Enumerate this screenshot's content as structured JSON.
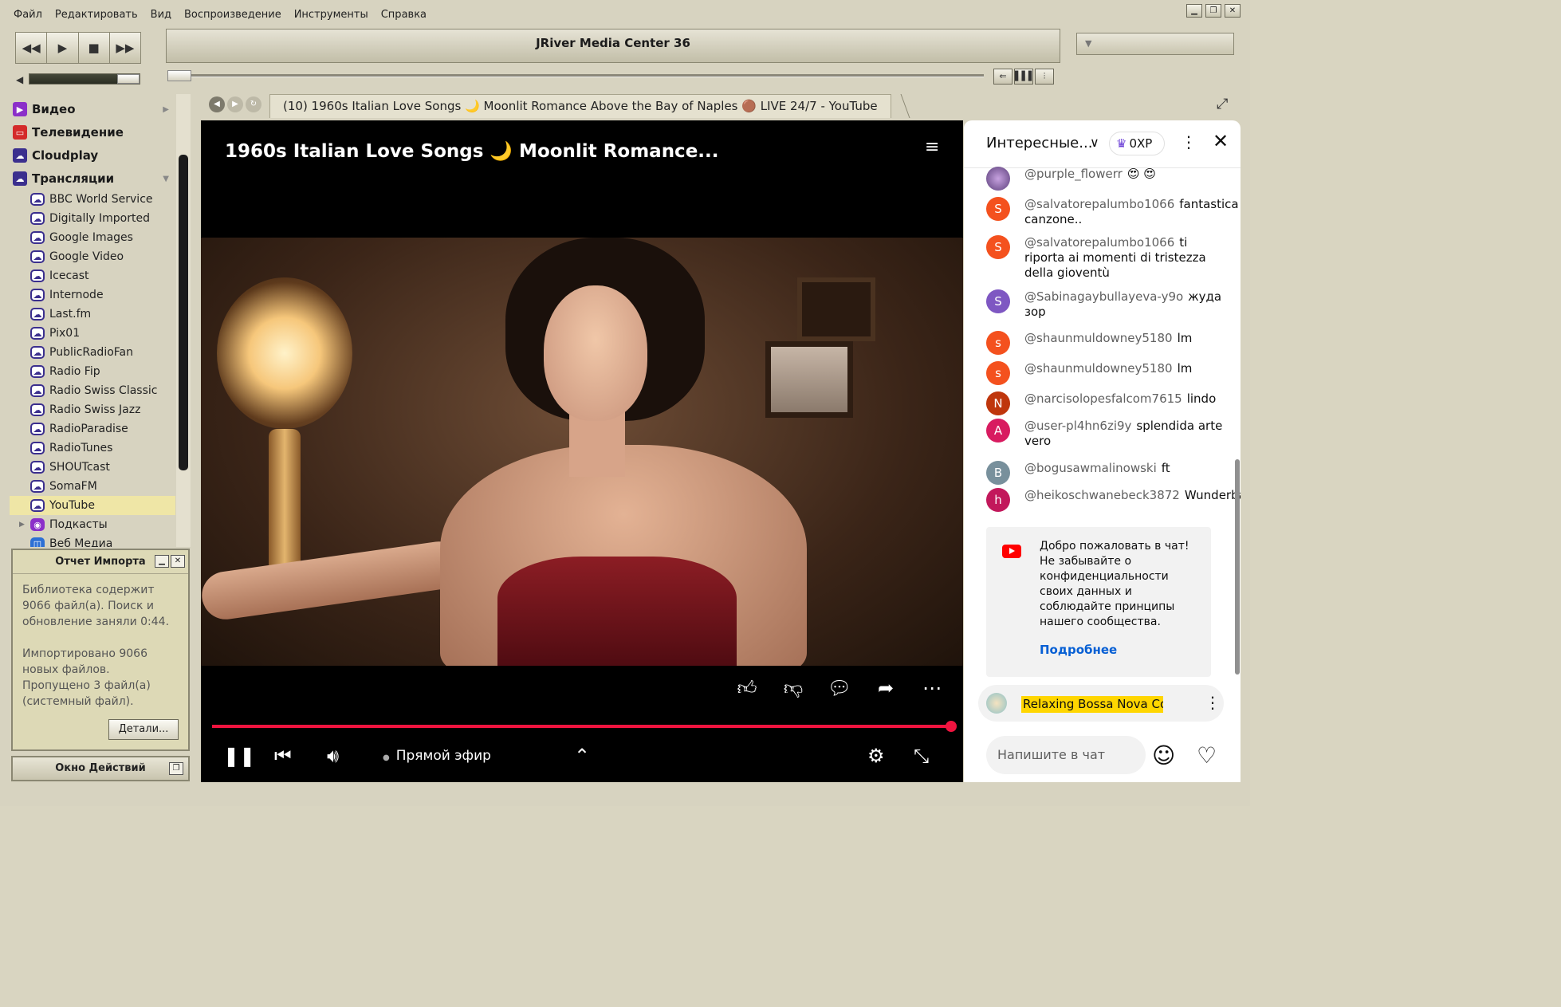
{
  "menubar": {
    "items": [
      "Файл",
      "Редактировать",
      "Вид",
      "Воспроизведение",
      "Инструменты",
      "Справка"
    ]
  },
  "window": {
    "title": "JRiver Media Center 36",
    "controls": [
      "minimize-icon",
      "restore-icon",
      "close-icon"
    ]
  },
  "transport": {
    "buttons": [
      "previous-icon",
      "play-icon",
      "stop-icon",
      "next-icon"
    ]
  },
  "volume": {
    "level": 0.8
  },
  "seek": {
    "position": 0.0
  },
  "view_buttons": [
    "back-icon",
    "equalizer-icon",
    "settings-sliders-icon"
  ],
  "tree": {
    "top": [
      {
        "label": "Видео",
        "color": "#8b2fc9",
        "icon": "video-icon"
      },
      {
        "label": "Телевидение",
        "color": "#d42a2a",
        "icon": "tv-icon"
      },
      {
        "label": "Cloudplay",
        "color": "#3b2f8e",
        "icon": "cloudplay-icon"
      },
      {
        "label": "Трансляции",
        "color": "#3b2f8e",
        "icon": "streaming-icon"
      }
    ],
    "streams": [
      "BBC World Service",
      "Digitally Imported",
      "Google Images",
      "Google Video",
      "Icecast",
      "Internode",
      "Last.fm",
      "Pix01",
      "PublicRadioFan",
      "Radio Fip",
      "Radio Swiss Classic",
      "Radio Swiss Jazz",
      "RadioParadise",
      "RadioTunes",
      "SHOUTcast",
      "SomaFM",
      "YouTube"
    ],
    "selected": "YouTube",
    "more": [
      {
        "label": "Подкасты",
        "color": "#8b2fc9",
        "icon": "podcast-icon"
      },
      {
        "label": "Веб Медиа",
        "color": "#2d6fd4",
        "icon": "web-media-icon"
      }
    ]
  },
  "import_report": {
    "title": "Отчет Импорта",
    "body": "Библиотека содержит 9066 файл(а). Поиск и обновление заняли 0:44.",
    "body2": "Импортировано 9066 новых файлов.",
    "body3": "Пропущено 3 файл(а) (системный файл).",
    "details_button": "Детали..."
  },
  "actions_window": {
    "title": "Окно Действий"
  },
  "tab": {
    "label": "(10) 1960s Italian Love Songs 🌙 Moonlit Romance Above the Bay of Naples 🟤 LIVE 24/7 - YouTube"
  },
  "video": {
    "title": "1960s Italian Love Songs 🌙 Moonlit Romance...",
    "live_label": "Прямой эфир",
    "progress": 1.0
  },
  "chat": {
    "title": "Интересные...",
    "xp": "0XP",
    "messages": [
      {
        "author": "@purple_flowerr",
        "text": "😍 😍",
        "avatar": "",
        "color": "#8a6fb3"
      },
      {
        "author": "@salvatorepalumbo1066",
        "text": "fantastica canzone..",
        "avatar": "S",
        "color": "#f4511e"
      },
      {
        "author": "@salvatorepalumbo1066",
        "text": "ti riporta ai momenti di tristezza della gioventù",
        "avatar": "S",
        "color": "#f4511e"
      },
      {
        "author": "@Sabinagaybullayeva-y9o",
        "text": "жуда зор",
        "avatar": "S",
        "color": "#7e57c2"
      },
      {
        "author": "@shaunmuldowney5180",
        "text": "lm",
        "avatar": "s",
        "color": "#f4511e"
      },
      {
        "author": "@shaunmuldowney5180",
        "text": "lm",
        "avatar": "s",
        "color": "#f4511e"
      },
      {
        "author": "@narcisolopesfalcom7615",
        "text": "lindo",
        "avatar": "N",
        "color": "#bf360c"
      },
      {
        "author": "@user-pl4hn6zi9y",
        "text": "splendida arte vero",
        "avatar": "A",
        "color": "#d81b60"
      },
      {
        "author": "@bogusawmalinowski",
        "text": "ft",
        "avatar": "B",
        "color": "#78909c"
      },
      {
        "author": "@heikoschwanebeck3872",
        "text": "Wunderbar",
        "avatar": "h",
        "color": "#c2185b"
      }
    ],
    "welcome": "Добро пожаловать в чат! Не забывайте о конфиденциальности своих данных и соблюдайте принципы нашего сообщества.",
    "welcome_link": "Подробнее",
    "ticker": "Relaxing Bossa Nova Cov",
    "input_placeholder": "Напишите в чат"
  }
}
